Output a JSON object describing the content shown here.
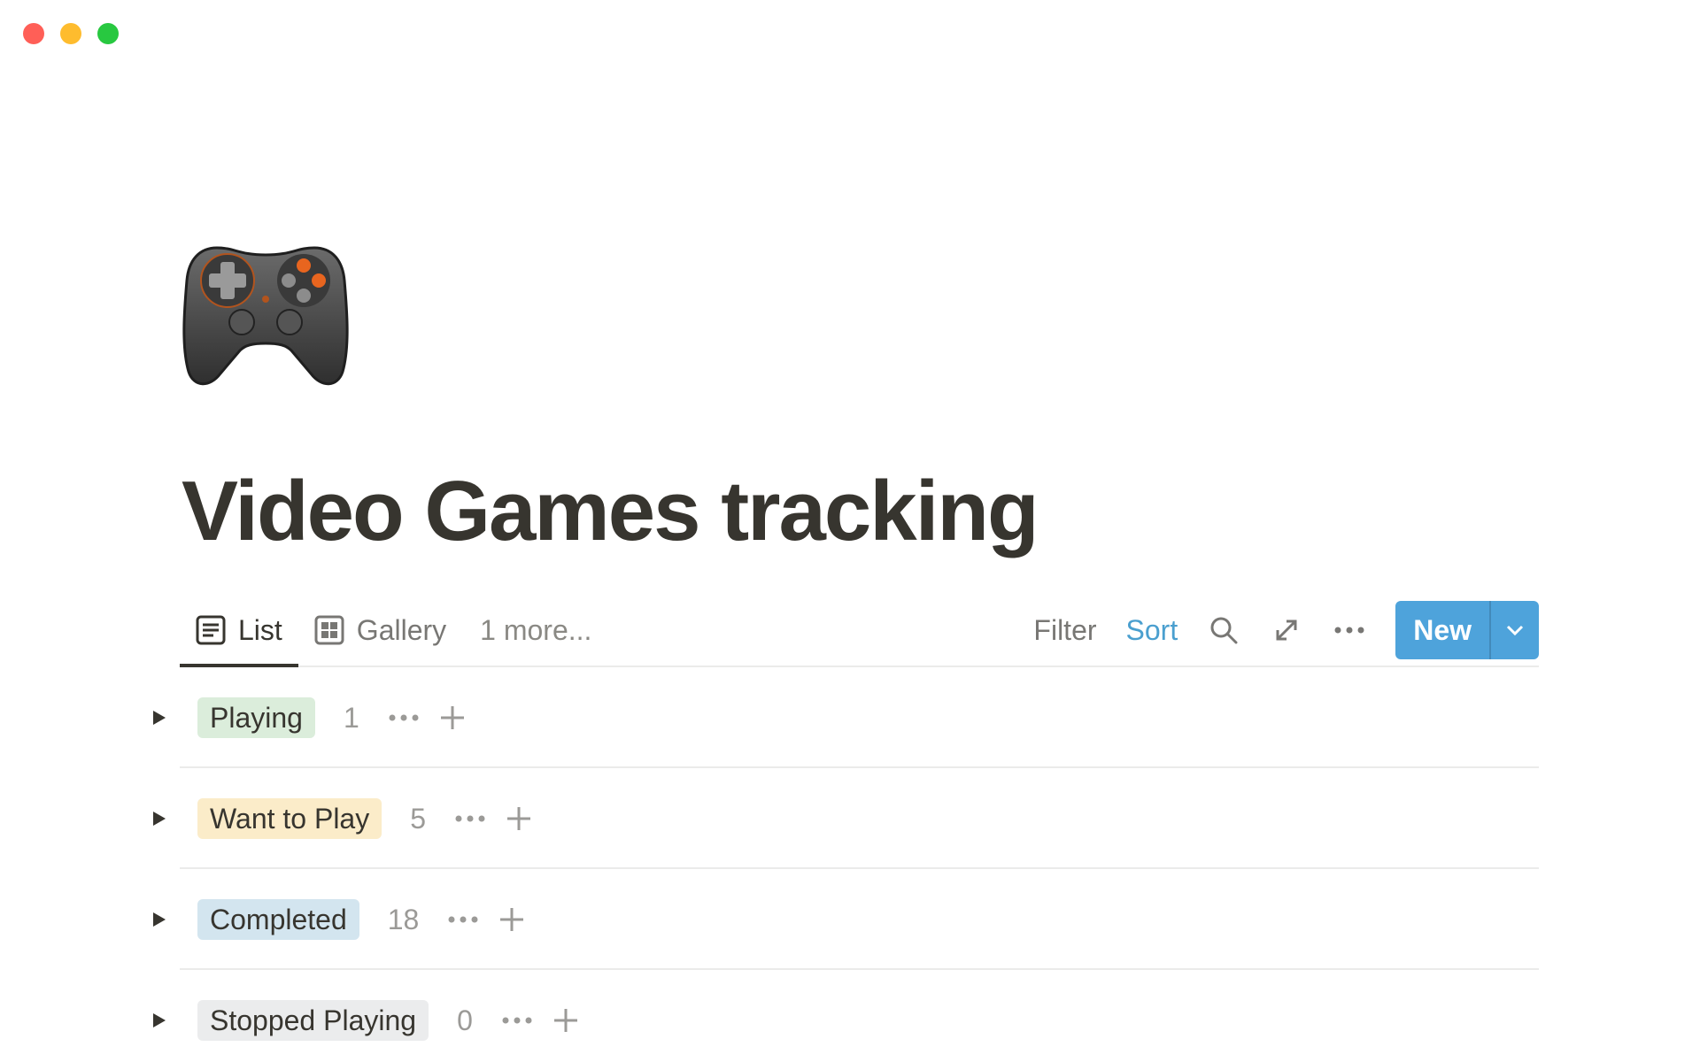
{
  "window": {
    "controls": [
      "close",
      "minimize",
      "zoom"
    ]
  },
  "page": {
    "icon": "game-controller-icon",
    "title": "Video Games tracking"
  },
  "views": {
    "tabs": [
      {
        "label": "List",
        "icon": "list-view-icon",
        "active": true
      },
      {
        "label": "Gallery",
        "icon": "gallery-view-icon",
        "active": false
      }
    ],
    "more_label": "1 more..."
  },
  "toolbar": {
    "filter_label": "Filter",
    "sort_label": "Sort",
    "search_icon": "search-icon",
    "expand_icon": "expand-icon",
    "more_icon": "more-options-icon",
    "new_label": "New",
    "new_dropdown_icon": "chevron-down-icon",
    "sort_color": "#4a9fcf",
    "new_color": "#4ea3db"
  },
  "groups": [
    {
      "label": "Playing",
      "count": "1",
      "color": "#dbeddb"
    },
    {
      "label": "Want to Play",
      "count": "5",
      "color": "#fbecc9"
    },
    {
      "label": "Completed",
      "count": "18",
      "color": "#d3e5ef"
    },
    {
      "label": "Stopped Playing",
      "count": "0",
      "color": "#ebeced"
    }
  ]
}
